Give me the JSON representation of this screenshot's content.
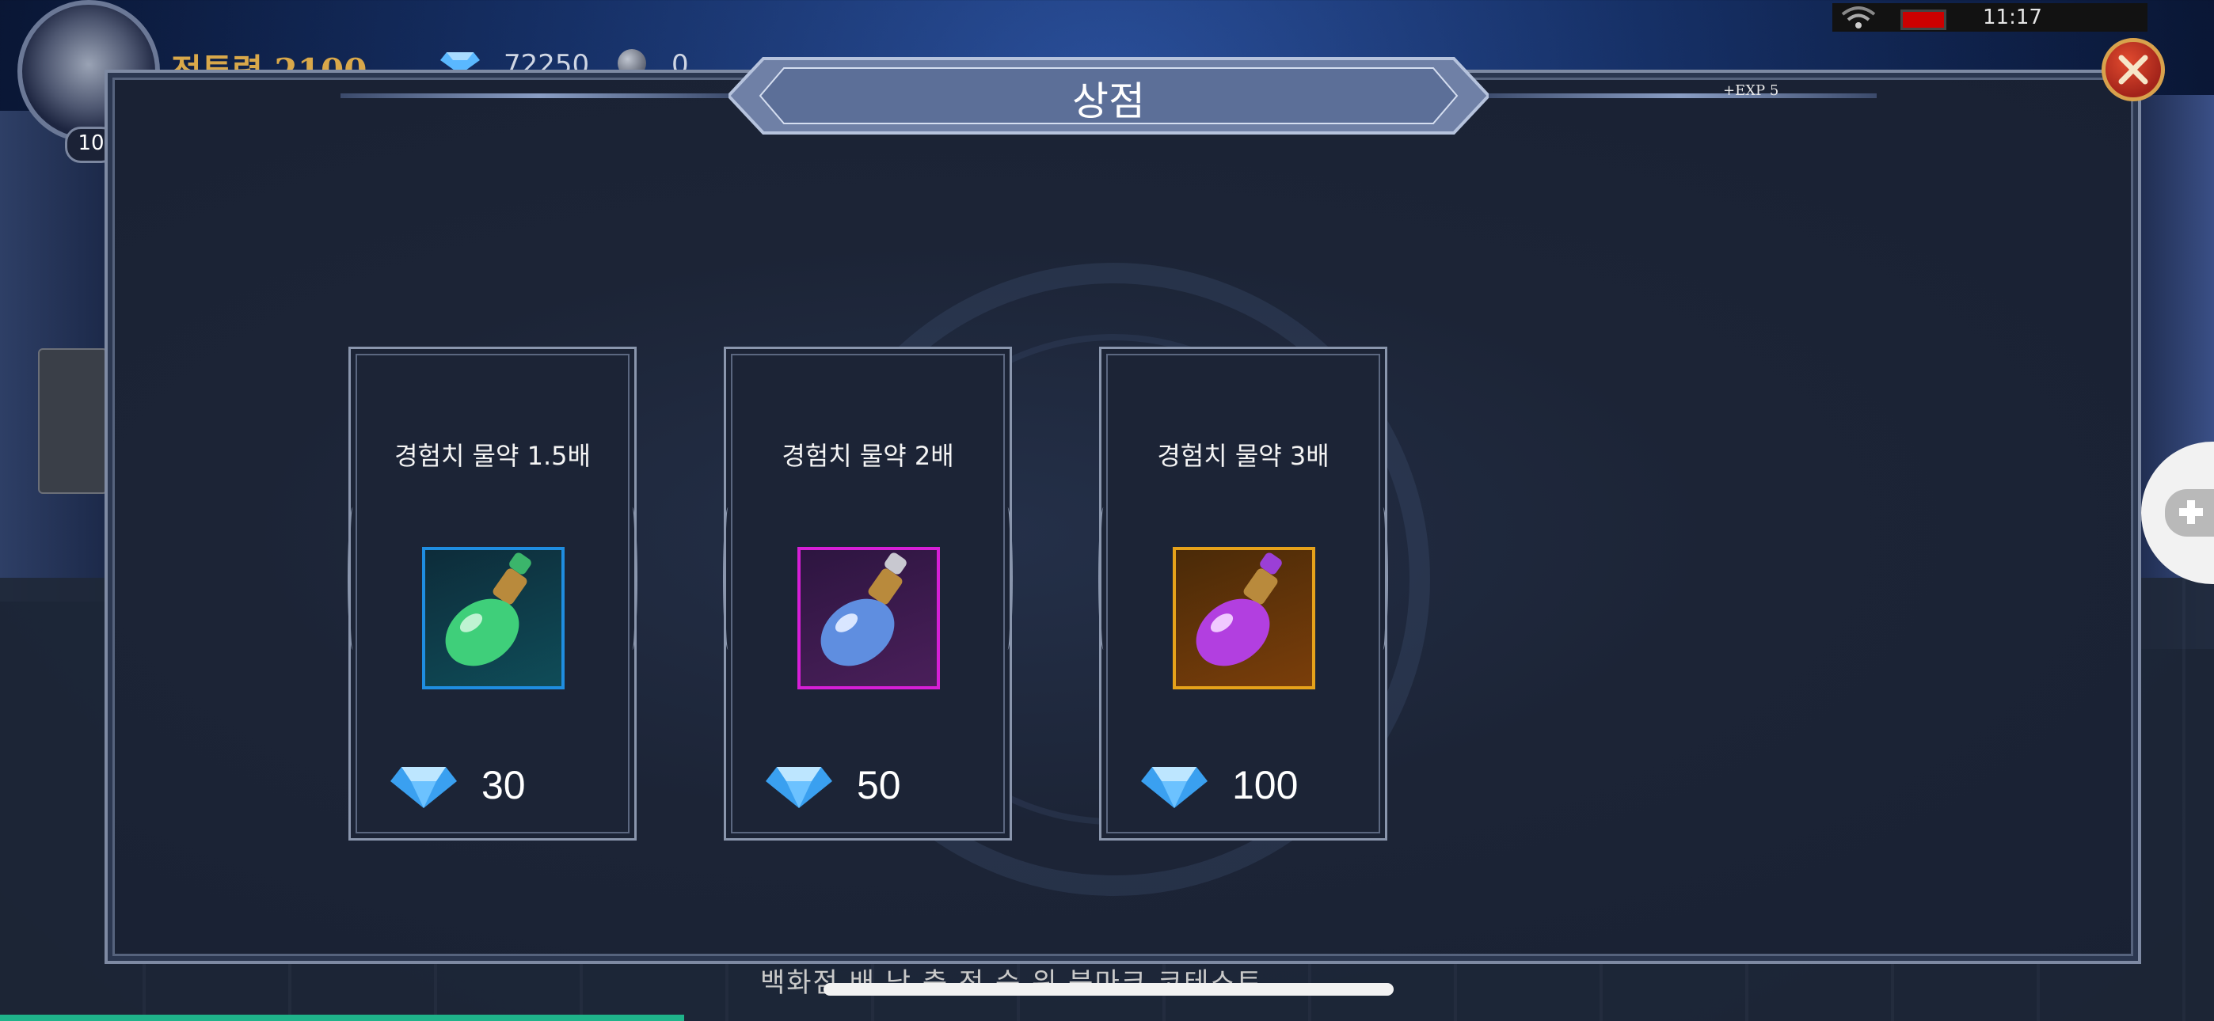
{
  "status": {
    "time": "11:17"
  },
  "hud": {
    "power": "전투력 2100",
    "gems": "72250",
    "orbs": "0",
    "level": "10"
  },
  "shop": {
    "title": "상점",
    "exp_tag": "+EXP 5",
    "items": [
      {
        "name": "경험치 물약 1.5배",
        "price": "30",
        "potion": "green",
        "frame": "#1f8de0"
      },
      {
        "name": "경험치 물약 2배",
        "price": "50",
        "potion": "blue",
        "frame": "#d61fd6"
      },
      {
        "name": "경험치 물약 3배",
        "price": "100",
        "potion": "purple",
        "frame": "#e6a21a"
      }
    ]
  },
  "bottom_menu": "백화점   배 낭   축 전   순 위   북마크   코테스트",
  "icons": {
    "close": "close-icon",
    "currency": "diamond-icon",
    "wifi": "wifi-icon",
    "battery": "battery-icon"
  }
}
